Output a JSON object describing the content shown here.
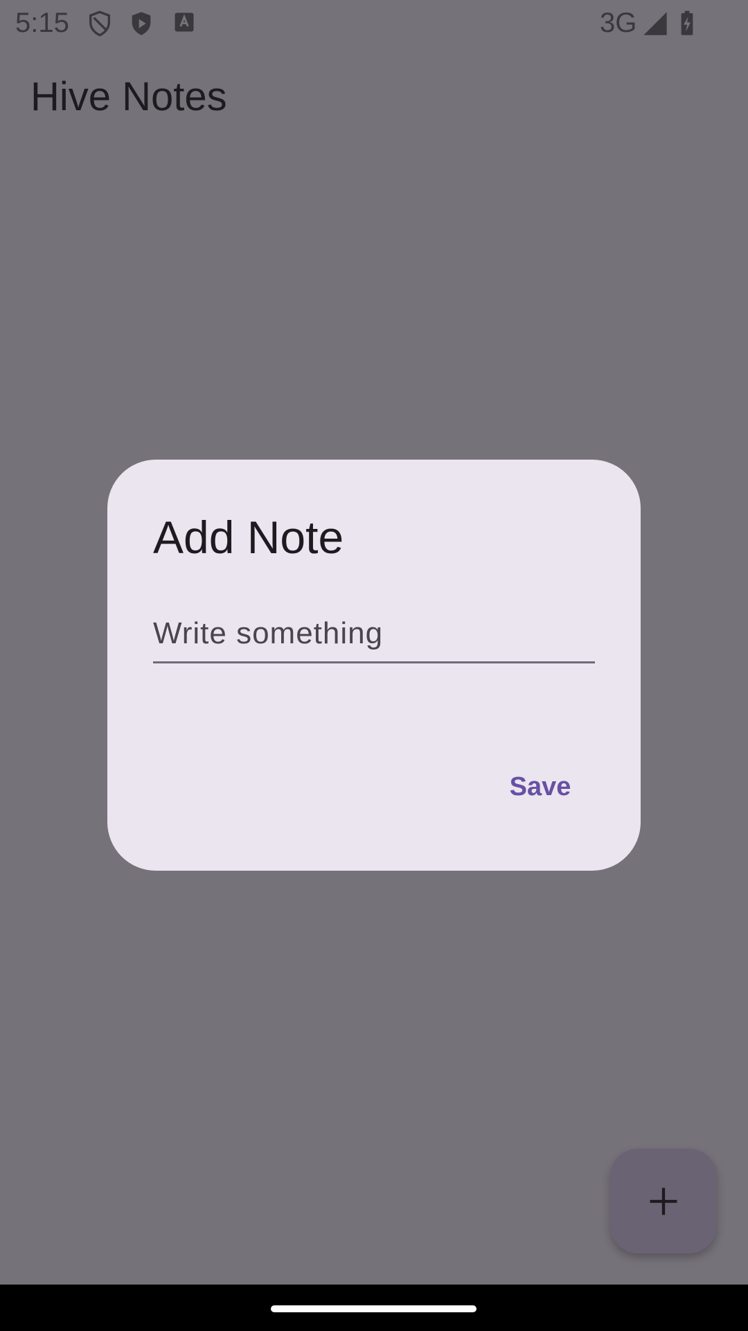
{
  "status_bar": {
    "time": "5:15",
    "network": "3G",
    "icons": [
      "shield-outline-icon",
      "shield-play-icon",
      "font-badge-icon",
      "signal-icon",
      "battery-charging-icon"
    ]
  },
  "app_bar": {
    "title": "Hive Notes"
  },
  "dialog": {
    "title": "Add Note",
    "input": {
      "placeholder": "Write something",
      "value": ""
    },
    "save_label": "Save"
  },
  "fab": {
    "icon": "plus-icon"
  },
  "colors": {
    "scrim": "#76727a",
    "dialog_bg": "#ebe5ef",
    "accent": "#6750a4",
    "fab_bg": "#6a6373"
  }
}
